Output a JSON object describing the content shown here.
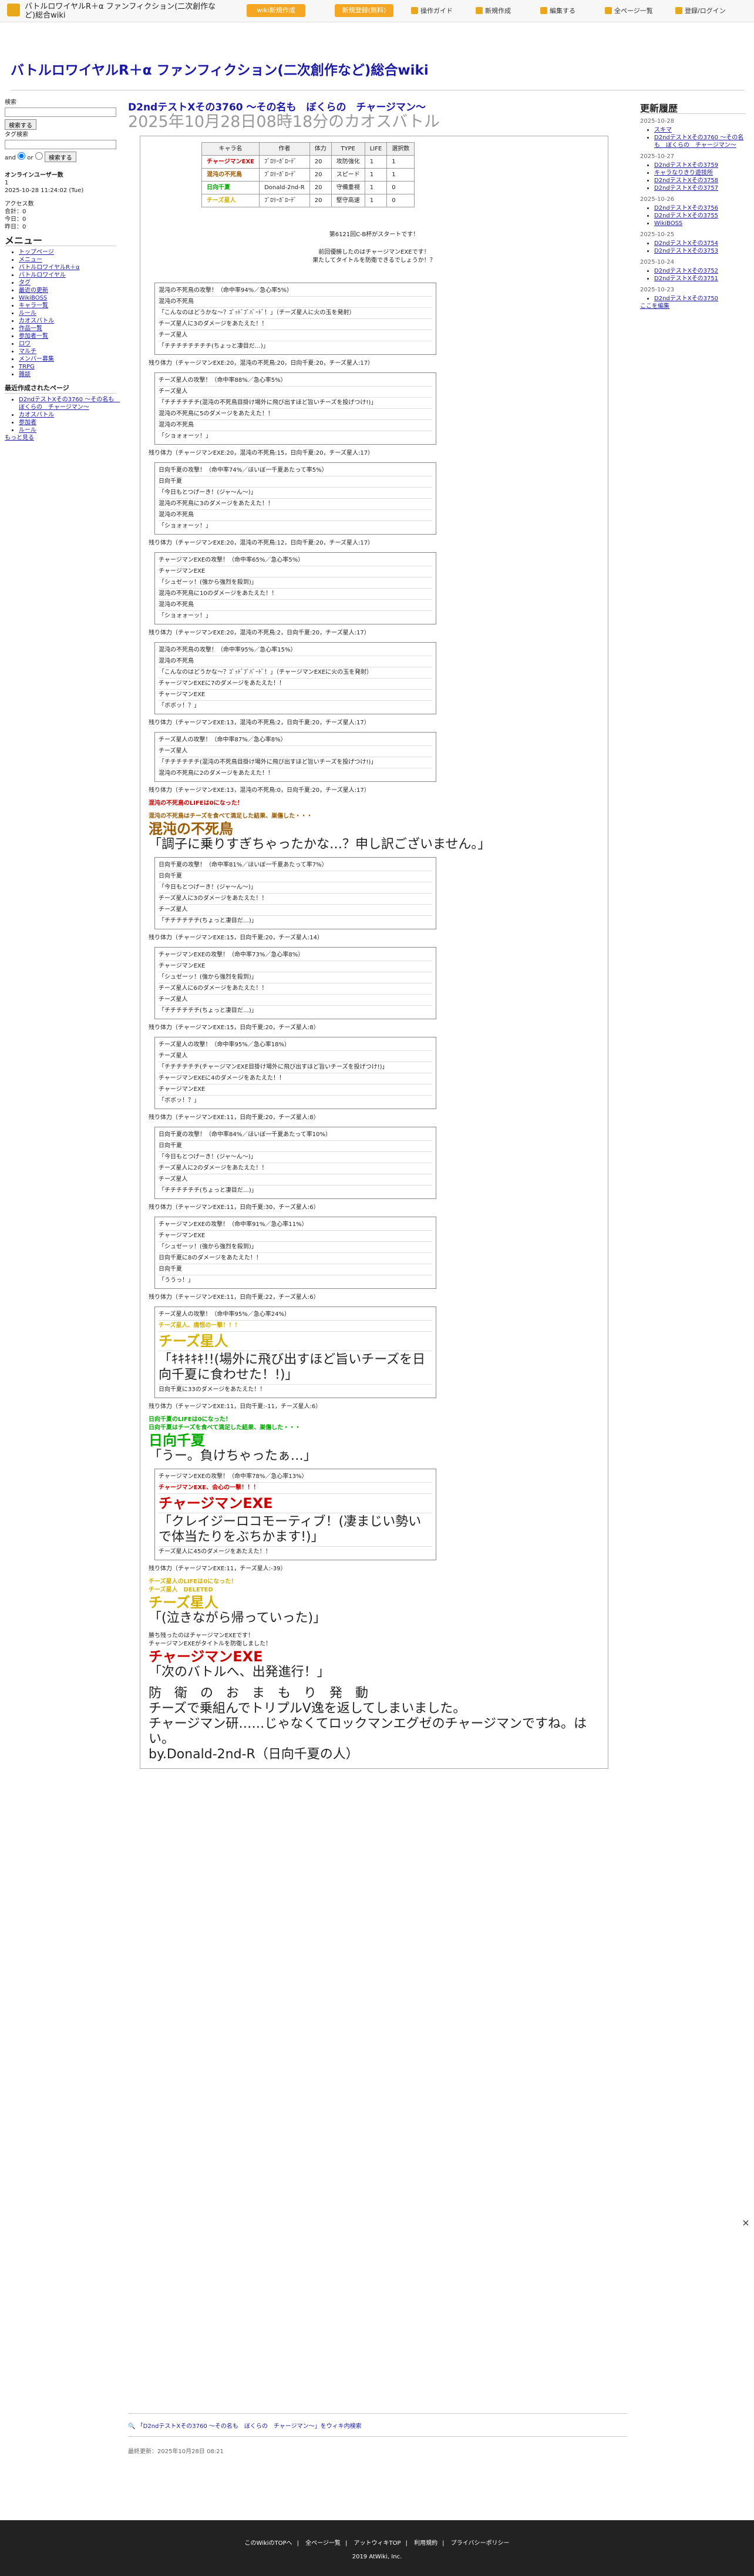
{
  "topbar": {
    "title": "バトルロワイヤルR＋α ファンフィクション(二次創作など)総合wiki",
    "btn_create": "wiki新規作成",
    "btn_signup": "新規登録(無料)",
    "links": [
      "操作ガイド",
      "新規作成",
      "編集する",
      "全ページ一覧",
      "登録/ログイン"
    ]
  },
  "wiki_title": "バトルロワイヤルR＋α ファンフィクション(二次創作など)総合wiki",
  "sidebar": {
    "search_label": "検索",
    "search_btn": "検索する",
    "tag_label": "タグ検索",
    "and": "and",
    "or": "or",
    "online": "オンラインユーザー数",
    "online_n": "1",
    "date": "2025-10-28 11:24:02 (Tue)",
    "access_label": "アクセス数",
    "total": "合計：0",
    "today": "今日：0",
    "yesterday": "昨日：0",
    "menu": "メニュー",
    "items": [
      "トップページ",
      "メニュー",
      "バトルロワイヤルR＋α",
      "バトルロワイヤル",
      "タグ",
      "最近の更新",
      "WikiBOSS",
      "キャラ一覧",
      "ルール",
      "カオスバトル",
      "作品一覧",
      "参加者一覧",
      "ロワ",
      "マルチ",
      "メンバー募集",
      "TRPG",
      "雑談"
    ],
    "recent": "最近作成されたページ",
    "recent_items": [
      "D2ndテストXその3760 〜その名も　ぼくらの　チャージマン〜",
      "カオスバトル",
      "参加者",
      "ルール"
    ],
    "more": "もっと見る"
  },
  "main": {
    "title": "D2ndテストXその3760 〜その名も　ぼくらの　チャージマン〜",
    "subtitle": "2025年10月28日08時18分のカオスバトル"
  },
  "table": {
    "headers": [
      "キャラ名",
      "作者",
      "体力",
      "TYPE",
      "LIFE",
      "選択数"
    ],
    "rows": [
      [
        "チャージマンEXE",
        "ﾌﾞﾛﾘｰｶﾞﾛｰﾃﾞ",
        "20",
        "攻防強化",
        "1",
        "1"
      ],
      [
        "混沌の不死鳥",
        "ﾌﾞﾛﾘｰｶﾞﾛｰﾃﾞ",
        "20",
        "スピード",
        "1",
        "1"
      ],
      [
        "日向千夏",
        "Donald-2nd-R",
        "20",
        "守備重視",
        "1",
        "0"
      ],
      [
        "チーズ星人",
        "ﾌﾞﾛﾘｰｶﾞﾛｰﾃﾞ",
        "20",
        "堅守高速",
        "1",
        "0"
      ]
    ]
  },
  "intro": [
    "第6121回C-B杯がスタートです！",
    "前回優勝したのはチャージマンEXEです！",
    "果たしてタイトルを防衛できるでしょうか！？"
  ],
  "logs": [
    {
      "rows": [
        "混沌の不死鳥の攻撃！（命中率94%／急心率5%）",
        "混沌の不死鳥",
        "「こんなのはどうかな〜？ｺﾞｯﾄﾞﾌﾞﾊﾞｰﾄﾞ！」（チーズ星人に火の玉を発射）",
        "チーズ星人に3のダメージをあたえた！！",
        "チーズ星人",
        "「チチチチチチチチ(ちょっと凄目だ…)」"
      ],
      "hp": "残り体力（チャージマンEXE:20，混沌の不死鳥:20，日向千夏:20，チーズ星人:17）"
    },
    {
      "rows": [
        "チーズ星人の攻撃！（命中率88%／急心率5%）",
        "チーズ星人",
        "「チチチチチチ(混沌の不死鳥目掛け場外に飛び出すほど旨いチーズを投げつけ!)」",
        "混沌の不死鳥に5のダメージをあたえた！！",
        "混沌の不死鳥",
        "「ショォォーッ！」"
      ],
      "hp": "残り体力（チャージマンEXE:20，混沌の不死鳥:15，日向千夏:20，チーズ星人:17）"
    },
    {
      "rows": [
        "日向千夏の攻撃！（命中率74%／ほいぼ一千夏あたって率5%）",
        "日向千夏",
        "「今日もとつげーき！(ジャ〜ん〜)」",
        "混沌の不死鳥に3のダメージをあたえた！！",
        "混沌の不死鳥",
        "「ショォォーッ！」"
      ],
      "hp": "残り体力（チャージマンEXE:20，混沌の不死鳥:12，日向千夏:20，チーズ星人:17）"
    },
    {
      "rows": [
        "チャージマンEXEの攻撃！（命中率65%／急心率5%）",
        "チャージマンEXE",
        "「シュゼーッ！(強から強烈を殺到)」",
        "混沌の不死鳥に10のダメージをあたえた！！",
        "混沌の不死鳥",
        "「ショォォーッ！」"
      ],
      "hp": "残り体力（チャージマンEXE:20，混沌の不死鳥:2，日向千夏:20，チーズ星人:17）"
    },
    {
      "rows": [
        "混沌の不死鳥の攻撃！（命中率95%／急心率15%）",
        "混沌の不死鳥",
        "「こんなのはどうかな〜？ｺﾞｯﾄﾞﾌﾞﾊﾞｰﾄﾞ！」（チャージマンEXEに火の玉を発射）",
        "チャージマンEXEに7のダメージをあたえた！！",
        "チャージマンEXE",
        "「ボボッ！？」"
      ],
      "hp": "残り体力（チャージマンEXE:13，混沌の不死鳥:2，日向千夏:20，チーズ星人:17）"
    },
    {
      "rows": [
        "チーズ星人の攻撃！（命中率87%／急心率8%）",
        "チーズ星人",
        "「チチチチチチ(混沌の不死鳥目掛け場外に飛び出すほど旨いチーズを投げつけ!)」",
        "混沌の不死鳥に2のダメージをあたえた！！"
      ],
      "hp": "残り体力（チャージマンEXE:13，混沌の不死鳥:0，日向千夏:20，チーズ星人:17）"
    }
  ],
  "death1": {
    "line1": "混沌の不死鳥のLIFEは0になった！",
    "line2": "混沌の不死鳥はチーズを食べて満足した結果、巣傷した・・・",
    "name": "混沌の不死鳥",
    "quote": "「調子に乗りすぎちゃったかな…？申し訳ございません。」"
  },
  "logs2": [
    {
      "rows": [
        "日向千夏の攻撃！（命中率81%／ほいぼ一千夏あたって率7%）",
        "日向千夏",
        "「今日もとつげーき！(ジャ〜ん〜)」",
        "チーズ星人に3のダメージをあたえた！！",
        "チーズ星人",
        "「チチチチチチ(ちょっと凄目だ…)」"
      ],
      "hp": "残り体力（チャージマンEXE:15，日向千夏:20，チーズ星人:14）"
    },
    {
      "rows": [
        "チャージマンEXEの攻撃！（命中率73%／急心率8%）",
        "チャージマンEXE",
        "「シュゼーッ！(強から強烈を殺到)」",
        "チーズ星人に6のダメージをあたえた！！",
        "チーズ星人",
        "「チチチチチチ(ちょっと凄目だ…)」"
      ],
      "hp": "残り体力（チャージマンEXE:15，日向千夏:20，チーズ星人:8）"
    },
    {
      "rows": [
        "チーズ星人の攻撃！（命中率95%／急心率18%）",
        "チーズ星人",
        "「チチチチチチ(チャージマンEXE目掛け場外に飛び出すほど旨いチーズを投げつけ!)」",
        "チャージマンEXEに4のダメージをあたえた！！",
        "チャージマンEXE",
        "「ボボッ！？」"
      ],
      "hp": "残り体力（チャージマンEXE:11，日向千夏:20，チーズ星人:8）"
    },
    {
      "rows": [
        "日向千夏の攻撃！（命中率84%／ほいぼ一千夏あたって率10%）",
        "日向千夏",
        "「今日もとつげーき！(ジャ〜ん〜)」",
        "チーズ星人に2のダメージをあたえた！！",
        "チーズ星人",
        "「チチチチチチ(ちょっと凄目だ…)」"
      ],
      "hp": "残り体力（チャージマンEXE:11，日向千夏:30，チーズ星人:6）"
    },
    {
      "rows": [
        "チャージマンEXEの攻撃！（命中率91%／急心率11%）",
        "チャージマンEXE",
        "「シュゼーッ！(強から強烈を殺到)」",
        "日向千夏に8のダメージをあたえた！！",
        "日向千夏",
        "「ううっ！」"
      ],
      "hp": "残り体力（チャージマンEXE:11，日向千夏:22，チーズ星人:6）"
    }
  ],
  "special": {
    "rows": [
      "チーズ星人の攻撃！（命中率95%／急心率24%）",
      "チーズ星人、痛恨の一撃！！！",
      "チーズ星人",
      "「ｷｷｷｷｷ!!(場外に飛び出すほど旨いチーズを日向千夏に食わせた！!)」",
      "日向千夏に33のダメージをあたえた！！"
    ],
    "hp": "残り体力（チャージマンEXE:11，日向千夏:-11，チーズ星人:6）"
  },
  "death2": {
    "line1": "日向千夏のLIFEは0になった！",
    "line2": "日向千夏はチーズを食べて満足した結果、巣傷した・・・",
    "name": "日向千夏",
    "quote": "「うー。負けちゃったぁ…」"
  },
  "special2": {
    "rows": [
      "チャージマンEXEの攻撃！（命中率78%／急心率13%）",
      "チャージマンEXE、会心の一撃！！！",
      "チャージマンEXE",
      "「クレイジーロコモーティブ！(凄まじい勢いで体当たりをぶちかます!)」",
      "チーズ星人に45のダメージをあたえた！！"
    ],
    "hp": "残り体力（チャージマンEXE:11，チーズ星人:-39）"
  },
  "death3": {
    "line1": "チーズ星人のLIFEは0になった！",
    "line2": "チーズ星人　DELETED",
    "name": "チーズ星人",
    "quote": "「(泣きながら帰っていった)」"
  },
  "ending": {
    "line1": "勝ち残ったのはチャージマンEXEです！",
    "line2": "チャージマンEXEがタイトルを防衛しました！",
    "name": "チャージマンEXE",
    "quote": "「次のバトルへ、出発進行！」",
    "c1": "防　衛　の　お　ま　も　り　発　動",
    "c2": "チーズで乗組んでトリプルV逸を返してしまいました。",
    "c3": "チャージマン研……じゃなくてロックマンエグゼのチャージマンですね。はい。",
    "c4": "by.Donald-2nd-R（日向千夏の人）"
  },
  "rightbar": {
    "title": "更新履歴",
    "groups": [
      {
        "date": "2025-10-28",
        "items": [
          "スキマ",
          "D2ndテストXその3760 〜その名も　ぼくらの　チャージマン〜"
        ]
      },
      {
        "date": "2025-10-27",
        "items": [
          "D2ndテストXその3759",
          "キャラなりきり遊技所",
          "D2ndテストXその3758",
          "D2ndテストXその3757"
        ]
      },
      {
        "date": "2025-10-26",
        "items": [
          "D2ndテストXその3756",
          "D2ndテストXその3755",
          "WikiBOSS"
        ]
      },
      {
        "date": "2025-10-25",
        "items": [
          "D2ndテストXその3754",
          "D2ndテストXその3753"
        ]
      },
      {
        "date": "2025-10-24",
        "items": [
          "D2ndテストXその3752",
          "D2ndテストXその3751"
        ]
      },
      {
        "date": "2025-10-23",
        "items": [
          "D2ndテストXその3750"
        ]
      }
    ],
    "more": "ここを編集"
  },
  "search_text": "「D2ndテストXその3760 〜その名も　ぼくらの　チャージマン〜」をウィキ内検索",
  "last_update": "最終更新：2025年10月28日 08:21",
  "footer": {
    "links": [
      "このWikiのTOPへ",
      "全ページ一覧",
      "アットウィキTOP",
      "利用規約",
      "プライバシーポリシー"
    ],
    "copyright": "2019 AtWiki, Inc."
  },
  "colors": {
    "accent": "#f5a623",
    "link": "#1a1aa6"
  }
}
